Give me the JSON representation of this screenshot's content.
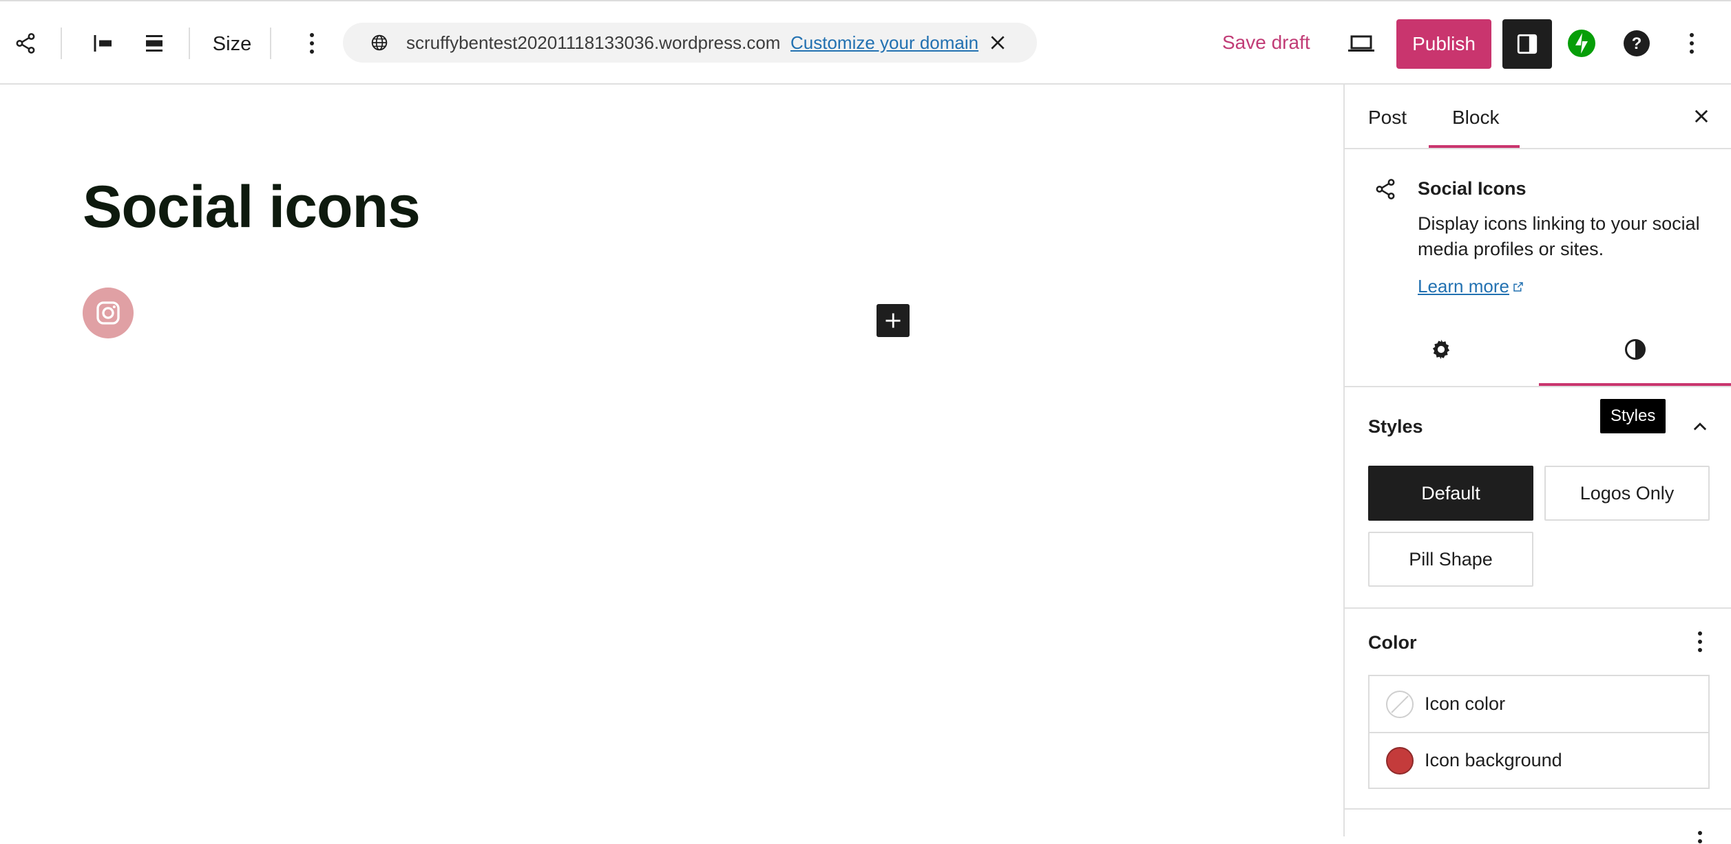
{
  "toolbar": {
    "size_label": "Size",
    "domain": "scruffybentest20201118133036.wordpress.com",
    "customize_link": "Customize your domain",
    "save_draft": "Save draft",
    "publish": "Publish",
    "icons": [
      "share-icon",
      "align-left-icon",
      "justify-icon",
      "more-vertical-icon",
      "globe-icon",
      "close-icon",
      "desktop-preview-icon",
      "sidebar-toggle-icon",
      "jetpack-icon",
      "help-icon",
      "options-icon"
    ]
  },
  "editor": {
    "title": "Social icons",
    "social_links": [
      {
        "service": "instagram",
        "icon": "instagram-icon",
        "background": "#e0a0a4"
      }
    ]
  },
  "sidebar": {
    "tabs": [
      {
        "label": "Post",
        "active": false
      },
      {
        "label": "Block",
        "active": true
      }
    ],
    "block_card": {
      "icon": "share-icon",
      "title": "Social Icons",
      "description": "Display icons linking to your social media profiles or sites.",
      "learn_more": "Learn more"
    },
    "sub_tabs": [
      {
        "name": "settings",
        "icon": "gear-icon",
        "active": false
      },
      {
        "name": "styles",
        "icon": "contrast-icon",
        "active": true
      }
    ],
    "tooltip": "Styles",
    "styles_panel": {
      "title": "Styles",
      "options": [
        {
          "label": "Default",
          "active": true
        },
        {
          "label": "Logos Only",
          "active": false
        },
        {
          "label": "Pill Shape",
          "active": false
        }
      ]
    },
    "color_panel": {
      "title": "Color",
      "items": [
        {
          "label": "Icon color",
          "swatch": "none"
        },
        {
          "label": "Icon background",
          "swatch": "#c43b3b"
        }
      ]
    }
  },
  "colors": {
    "accent": "#c9356e",
    "link": "#2271b1",
    "dark": "#1e1e1e",
    "jetpack_green": "#069e08"
  }
}
